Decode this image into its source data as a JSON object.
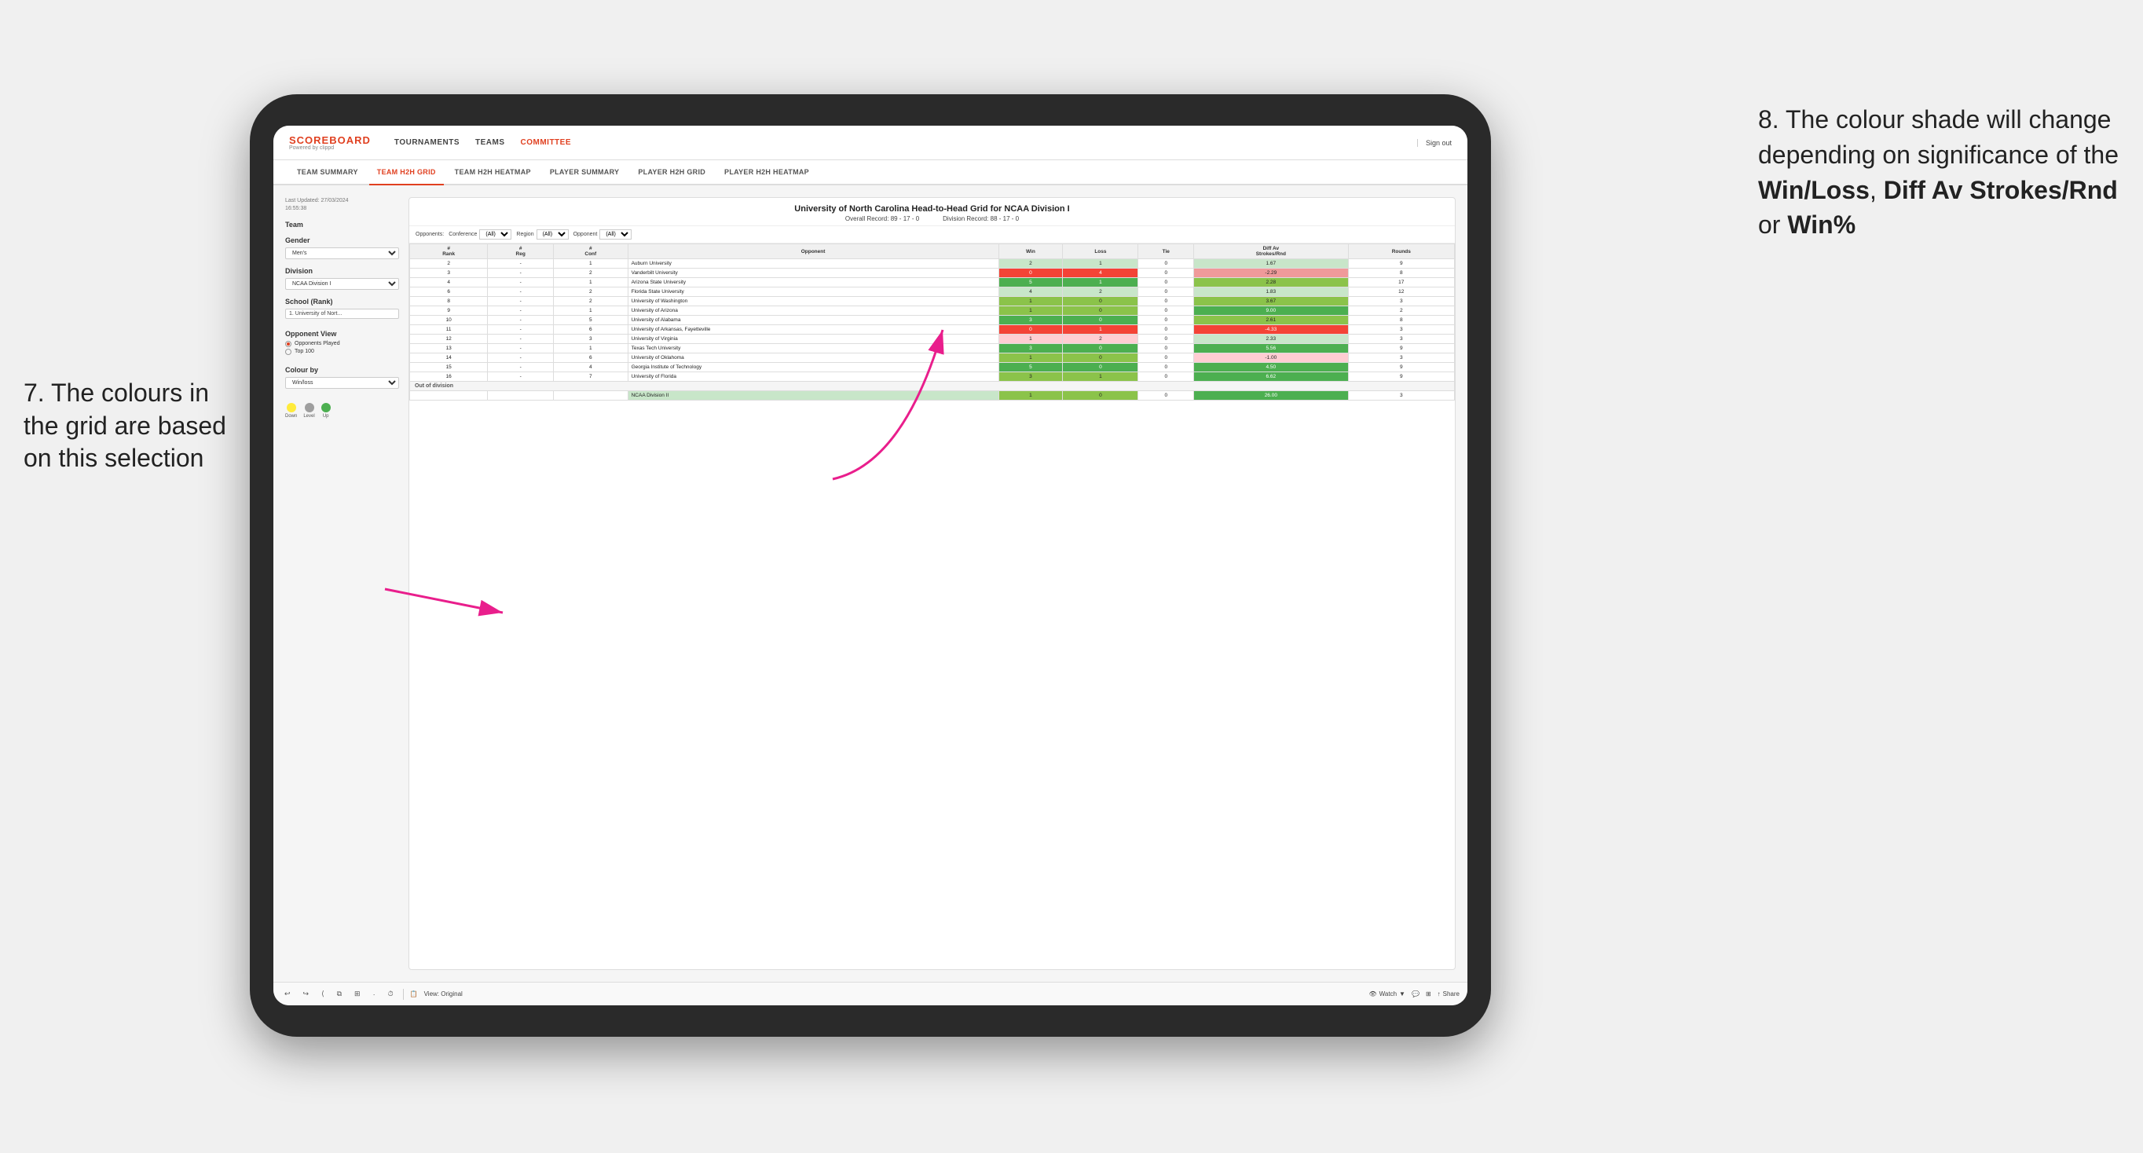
{
  "annotations": {
    "left_title": "7. The colours in the grid are based on this selection",
    "right_title": "8. The colour shade will change depending on significance of the ",
    "right_bold1": "Win/Loss",
    "right_sep1": ", ",
    "right_bold2": "Diff Av Strokes/Rnd",
    "right_sep2": " or ",
    "right_bold3": "Win%"
  },
  "nav": {
    "logo": "SCOREBOARD",
    "logo_sub": "Powered by clippd",
    "links": [
      "TOURNAMENTS",
      "TEAMS",
      "COMMITTEE"
    ],
    "sign_out": "Sign out"
  },
  "sub_nav": {
    "items": [
      "TEAM SUMMARY",
      "TEAM H2H GRID",
      "TEAM H2H HEATMAP",
      "PLAYER SUMMARY",
      "PLAYER H2H GRID",
      "PLAYER H2H HEATMAP"
    ],
    "active": "TEAM H2H GRID"
  },
  "left_panel": {
    "last_updated_label": "Last Updated: 27/03/2024",
    "last_updated_time": "16:55:38",
    "team_label": "Team",
    "gender_label": "Gender",
    "gender_value": "Men's",
    "division_label": "Division",
    "division_value": "NCAA Division I",
    "school_label": "School (Rank)",
    "school_value": "1. University of Nort...",
    "opponent_view_label": "Opponent View",
    "radio_options": [
      "Opponents Played",
      "Top 100"
    ],
    "radio_selected": "Opponents Played",
    "colour_by_label": "Colour by",
    "colour_by_value": "Win/loss",
    "legend": [
      {
        "color": "#ffeb3b",
        "label": "Down"
      },
      {
        "color": "#9e9e9e",
        "label": "Level"
      },
      {
        "color": "#4caf50",
        "label": "Up"
      }
    ]
  },
  "grid": {
    "title": "University of North Carolina Head-to-Head Grid for NCAA Division I",
    "overall_record": "Overall Record: 89 - 17 - 0",
    "division_record": "Division Record: 88 - 17 - 0",
    "filters": {
      "opponents_label": "Opponents:",
      "conference_label": "Conference",
      "conference_value": "(All)",
      "region_label": "Region",
      "region_value": "(All)",
      "opponent_label": "Opponent",
      "opponent_value": "(All)"
    },
    "columns": [
      "#\nRank",
      "#\nReg",
      "#\nConf",
      "Opponent",
      "Win",
      "Loss",
      "Tie",
      "Diff Av\nStrokes/Rnd",
      "Rounds"
    ],
    "rows": [
      {
        "rank": "2",
        "reg": "-",
        "conf": "1",
        "team": "Auburn University",
        "win": "2",
        "loss": "1",
        "tie": "0",
        "diff": "1.67",
        "rounds": "9",
        "win_color": "green-light",
        "diff_color": "green-light"
      },
      {
        "rank": "3",
        "reg": "-",
        "conf": "2",
        "team": "Vanderbilt University",
        "win": "0",
        "loss": "4",
        "tie": "0",
        "diff": "-2.29",
        "rounds": "8",
        "win_color": "red-dark",
        "diff_color": "red-mid"
      },
      {
        "rank": "4",
        "reg": "-",
        "conf": "1",
        "team": "Arizona State University",
        "win": "5",
        "loss": "1",
        "tie": "0",
        "diff": "2.28",
        "rounds": "17",
        "win_color": "green-dark",
        "diff_color": "green-mid"
      },
      {
        "rank": "6",
        "reg": "-",
        "conf": "2",
        "team": "Florida State University",
        "win": "4",
        "loss": "2",
        "tie": "0",
        "diff": "1.83",
        "rounds": "12",
        "win_color": "green-light",
        "diff_color": "green-light"
      },
      {
        "rank": "8",
        "reg": "-",
        "conf": "2",
        "team": "University of Washington",
        "win": "1",
        "loss": "0",
        "tie": "0",
        "diff": "3.67",
        "rounds": "3",
        "win_color": "green-mid",
        "diff_color": "green-mid"
      },
      {
        "rank": "9",
        "reg": "-",
        "conf": "1",
        "team": "University of Arizona",
        "win": "1",
        "loss": "0",
        "tie": "0",
        "diff": "9.00",
        "rounds": "2",
        "win_color": "green-mid",
        "diff_color": "green-dark"
      },
      {
        "rank": "10",
        "reg": "-",
        "conf": "5",
        "team": "University of Alabama",
        "win": "3",
        "loss": "0",
        "tie": "0",
        "diff": "2.61",
        "rounds": "8",
        "win_color": "green-dark",
        "diff_color": "green-mid"
      },
      {
        "rank": "11",
        "reg": "-",
        "conf": "6",
        "team": "University of Arkansas, Fayetteville",
        "win": "0",
        "loss": "1",
        "tie": "0",
        "diff": "-4.33",
        "rounds": "3",
        "win_color": "red-dark",
        "diff_color": "red-dark"
      },
      {
        "rank": "12",
        "reg": "-",
        "conf": "3",
        "team": "University of Virginia",
        "win": "1",
        "loss": "2",
        "tie": "0",
        "diff": "2.33",
        "rounds": "3",
        "win_color": "red-light",
        "diff_color": "green-light"
      },
      {
        "rank": "13",
        "reg": "-",
        "conf": "1",
        "team": "Texas Tech University",
        "win": "3",
        "loss": "0",
        "tie": "0",
        "diff": "5.56",
        "rounds": "9",
        "win_color": "green-dark",
        "diff_color": "green-dark"
      },
      {
        "rank": "14",
        "reg": "-",
        "conf": "6",
        "team": "University of Oklahoma",
        "win": "1",
        "loss": "0",
        "tie": "0",
        "diff": "-1.00",
        "rounds": "3",
        "win_color": "green-mid",
        "diff_color": "red-light"
      },
      {
        "rank": "15",
        "reg": "-",
        "conf": "4",
        "team": "Georgia Institute of Technology",
        "win": "5",
        "loss": "0",
        "tie": "0",
        "diff": "4.50",
        "rounds": "9",
        "win_color": "green-dark",
        "diff_color": "green-dark"
      },
      {
        "rank": "16",
        "reg": "-",
        "conf": "7",
        "team": "University of Florida",
        "win": "3",
        "loss": "1",
        "tie": "0",
        "diff": "6.62",
        "rounds": "9",
        "win_color": "green-mid",
        "diff_color": "green-dark"
      }
    ],
    "out_of_division_label": "Out of division",
    "out_of_division_row": {
      "team": "NCAA Division II",
      "win": "1",
      "loss": "0",
      "tie": "0",
      "diff": "26.00",
      "rounds": "3",
      "win_color": "green-mid",
      "diff_color": "green-dark"
    }
  },
  "toolbar": {
    "view_label": "View: Original",
    "watch_label": "Watch",
    "share_label": "Share"
  }
}
